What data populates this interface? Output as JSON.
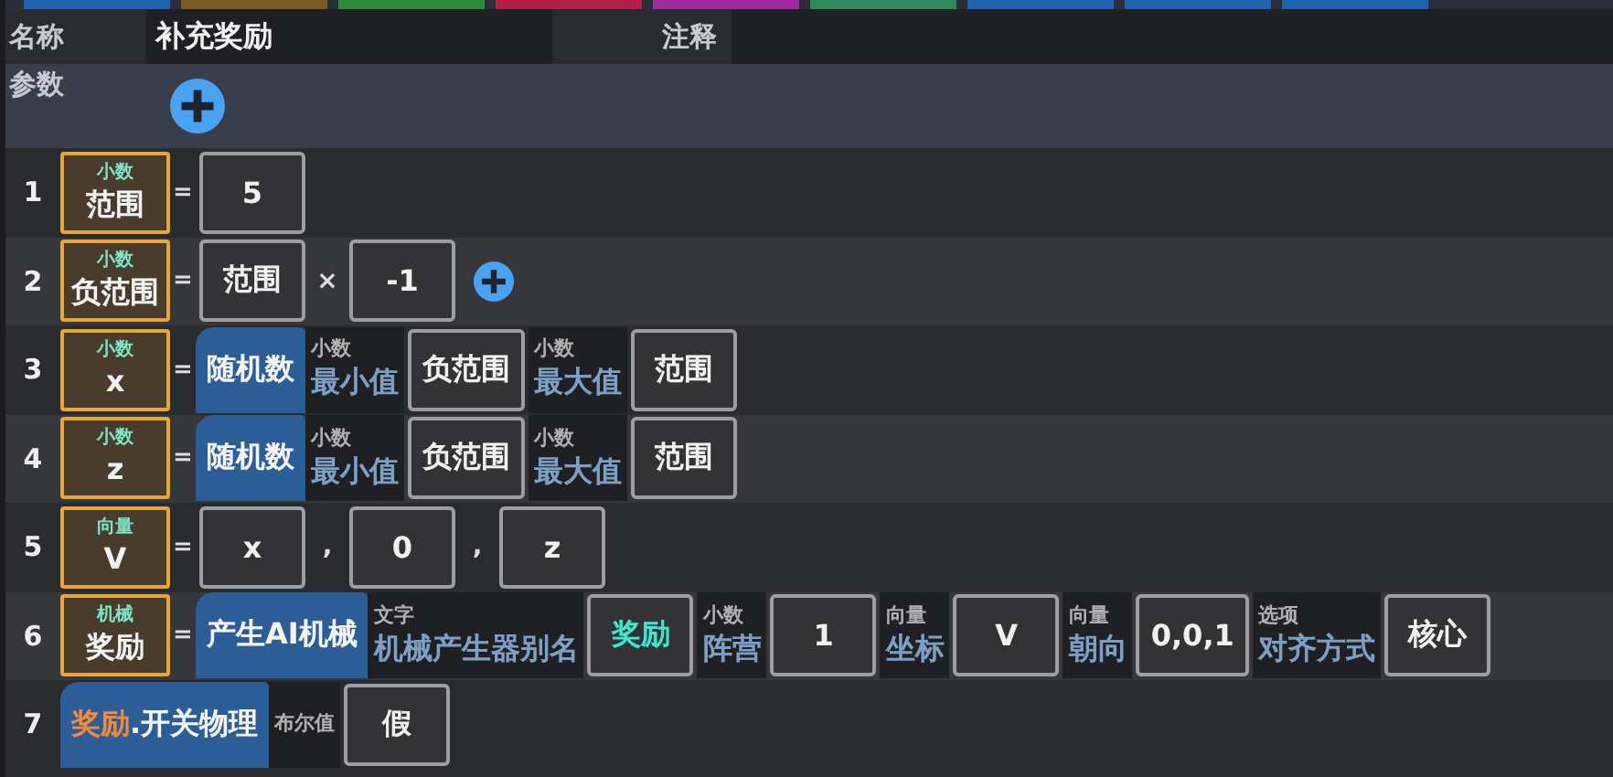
{
  "tab_strip": [
    {
      "color": "#1f63b0"
    },
    {
      "color": "#7a5a26"
    },
    {
      "color": "#2f8a3c"
    },
    {
      "color": "#b0204a"
    },
    {
      "color": "#a02aa0"
    },
    {
      "color": "#2f8a5a"
    },
    {
      "color": "#1f63b0"
    },
    {
      "color": "#1f63b0"
    },
    {
      "color": "#1f63b0"
    }
  ],
  "name_label": "名称",
  "name_value": "补充奖励",
  "comment_label": "注释",
  "params_label": "参数",
  "rows": [
    {
      "number": "1",
      "target": {
        "type": "小数",
        "name": "范围"
      },
      "items": [
        {
          "kind": "eq",
          "text": "="
        },
        {
          "kind": "value",
          "text": "5",
          "highlighted": false
        }
      ]
    },
    {
      "number": "2",
      "target": {
        "type": "小数",
        "name": "负范围"
      },
      "items": [
        {
          "kind": "eq",
          "text": "="
        },
        {
          "kind": "value",
          "text": "范围",
          "highlighted": false
        },
        {
          "kind": "op",
          "text": "×"
        },
        {
          "kind": "value",
          "text": "-1",
          "highlighted": false
        },
        {
          "kind": "add"
        }
      ]
    },
    {
      "number": "3",
      "target": {
        "type": "小数",
        "name": "x"
      },
      "items": [
        {
          "kind": "eq",
          "text": "="
        },
        {
          "kind": "func",
          "text": "随机数"
        },
        {
          "kind": "param",
          "type": "小数",
          "name": "最小值"
        },
        {
          "kind": "value",
          "text": "负范围",
          "highlighted": false
        },
        {
          "kind": "param",
          "type": "小数",
          "name": "最大值"
        },
        {
          "kind": "value",
          "text": "范围",
          "highlighted": false
        }
      ]
    },
    {
      "number": "4",
      "target": {
        "type": "小数",
        "name": "z"
      },
      "items": [
        {
          "kind": "eq",
          "text": "="
        },
        {
          "kind": "func",
          "text": "随机数"
        },
        {
          "kind": "param",
          "type": "小数",
          "name": "最小值"
        },
        {
          "kind": "value",
          "text": "负范围",
          "highlighted": false
        },
        {
          "kind": "param",
          "type": "小数",
          "name": "最大值"
        },
        {
          "kind": "value",
          "text": "范围",
          "highlighted": false
        }
      ]
    },
    {
      "number": "5",
      "target": {
        "type": "向量",
        "name": "V"
      },
      "items": [
        {
          "kind": "eq",
          "text": "="
        },
        {
          "kind": "value",
          "text": "x",
          "highlighted": false
        },
        {
          "kind": "op",
          "text": ","
        },
        {
          "kind": "value",
          "text": "0",
          "highlighted": false
        },
        {
          "kind": "op",
          "text": ","
        },
        {
          "kind": "value",
          "text": "z",
          "highlighted": false
        }
      ]
    },
    {
      "number": "6",
      "target": {
        "type": "机械",
        "name": "奖励"
      },
      "items": [
        {
          "kind": "eq",
          "text": "="
        },
        {
          "kind": "func",
          "text": "产生AI机械"
        },
        {
          "kind": "param",
          "type": "文字",
          "name": "机械产生器别名"
        },
        {
          "kind": "value",
          "text": "奖励",
          "highlighted": true
        },
        {
          "kind": "param",
          "type": "小数",
          "name": "阵营"
        },
        {
          "kind": "value",
          "text": "1",
          "highlighted": false
        },
        {
          "kind": "param",
          "type": "向量",
          "name": "坐标"
        },
        {
          "kind": "value",
          "text": "V",
          "highlighted": false
        },
        {
          "kind": "param",
          "type": "向量",
          "name": "朝向"
        },
        {
          "kind": "value",
          "text": "0,0,1",
          "highlighted": false
        },
        {
          "kind": "param",
          "type": "选项",
          "name": "对齐方式"
        },
        {
          "kind": "value",
          "text": "核心",
          "highlighted": false
        }
      ]
    },
    {
      "number": "7",
      "items": [
        {
          "kind": "method",
          "object": "奖励",
          "text": ".开关物理"
        },
        {
          "kind": "param",
          "type": "布尔值"
        },
        {
          "kind": "value",
          "text": "假",
          "highlighted": false
        }
      ]
    }
  ]
}
